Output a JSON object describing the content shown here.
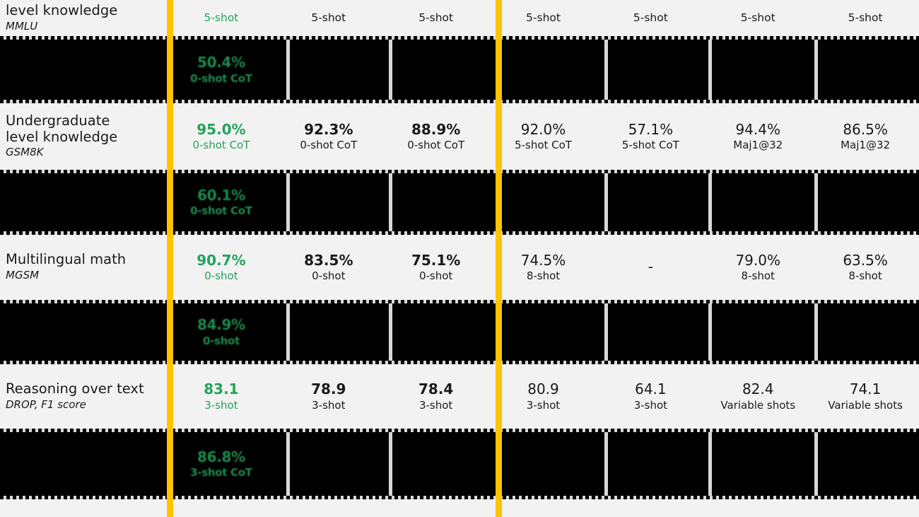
{
  "theme": {
    "accent_rail": "#ffc400",
    "highlight_green": "#23a35b",
    "page_bg": "#f2f2f2",
    "masked_bg": "#000000"
  },
  "columns": [
    {
      "id": "col-1",
      "group": "primary",
      "highlight": true
    },
    {
      "id": "col-2",
      "group": "primary",
      "highlight": false
    },
    {
      "id": "col-3",
      "group": "primary",
      "highlight": false
    },
    {
      "id": "col-4",
      "group": "secondary",
      "highlight": false
    },
    {
      "id": "col-5",
      "group": "secondary",
      "highlight": false
    },
    {
      "id": "col-6",
      "group": "secondary",
      "highlight": false
    },
    {
      "id": "col-7",
      "group": "secondary",
      "highlight": false
    }
  ],
  "rows": [
    {
      "kind": "light",
      "name": "mmlu-row",
      "label": {
        "title": "level knowledge",
        "sub": "MMLU"
      },
      "cells": [
        {
          "num": "",
          "shot": "5-shot"
        },
        {
          "num": "",
          "shot": "5-shot"
        },
        {
          "num": "",
          "shot": "5-shot"
        },
        {
          "num": "",
          "shot": "5-shot"
        },
        {
          "num": "",
          "shot": "5-shot"
        },
        {
          "num": "",
          "shot": "5-shot"
        },
        {
          "num": "",
          "shot": "5-shot"
        }
      ]
    },
    {
      "kind": "masked",
      "name": "masked-row-1",
      "label": {
        "title": "",
        "sub": ""
      },
      "cells": [
        {
          "num": "50.4%",
          "shot": "0-shot CoT"
        },
        {
          "num": "",
          "shot": ""
        },
        {
          "num": "",
          "shot": ""
        },
        {
          "num": "",
          "shot": ""
        },
        {
          "num": "",
          "shot": ""
        },
        {
          "num": "",
          "shot": ""
        },
        {
          "num": "",
          "shot": ""
        }
      ]
    },
    {
      "kind": "light",
      "name": "gsm8k-row",
      "label": {
        "title": "Undergraduate\nlevel knowledge",
        "sub": "GSM8K"
      },
      "cells": [
        {
          "num": "95.0%",
          "shot": "0-shot CoT"
        },
        {
          "num": "92.3%",
          "shot": "0-shot CoT"
        },
        {
          "num": "88.9%",
          "shot": "0-shot CoT"
        },
        {
          "num": "92.0%",
          "shot": "5-shot CoT"
        },
        {
          "num": "57.1%",
          "shot": "5-shot CoT"
        },
        {
          "num": "94.4%",
          "shot": "Maj1@32"
        },
        {
          "num": "86.5%",
          "shot": "Maj1@32"
        }
      ]
    },
    {
      "kind": "masked",
      "name": "masked-row-2",
      "label": {
        "title": "",
        "sub": ""
      },
      "cells": [
        {
          "num": "60.1%",
          "shot": "0-shot CoT"
        },
        {
          "num": "",
          "shot": ""
        },
        {
          "num": "",
          "shot": ""
        },
        {
          "num": "",
          "shot": ""
        },
        {
          "num": "",
          "shot": ""
        },
        {
          "num": "",
          "shot": ""
        },
        {
          "num": "",
          "shot": ""
        }
      ]
    },
    {
      "kind": "light",
      "name": "mgsm-row",
      "label": {
        "title": "Multilingual math",
        "sub": "MGSM"
      },
      "cells": [
        {
          "num": "90.7%",
          "shot": "0-shot"
        },
        {
          "num": "83.5%",
          "shot": "0-shot"
        },
        {
          "num": "75.1%",
          "shot": "0-shot"
        },
        {
          "num": "74.5%",
          "shot": "8-shot"
        },
        {
          "num": "-",
          "shot": ""
        },
        {
          "num": "79.0%",
          "shot": "8-shot"
        },
        {
          "num": "63.5%",
          "shot": "8-shot"
        }
      ]
    },
    {
      "kind": "masked",
      "name": "masked-row-3",
      "label": {
        "title": "",
        "sub": ""
      },
      "cells": [
        {
          "num": "84.9%",
          "shot": "0-shot"
        },
        {
          "num": "",
          "shot": ""
        },
        {
          "num": "",
          "shot": ""
        },
        {
          "num": "",
          "shot": ""
        },
        {
          "num": "",
          "shot": ""
        },
        {
          "num": "",
          "shot": ""
        },
        {
          "num": "",
          "shot": ""
        }
      ]
    },
    {
      "kind": "light",
      "name": "drop-row",
      "label": {
        "title": "Reasoning over text",
        "sub": "DROP, F1 score"
      },
      "cells": [
        {
          "num": "83.1",
          "shot": "3-shot"
        },
        {
          "num": "78.9",
          "shot": "3-shot"
        },
        {
          "num": "78.4",
          "shot": "3-shot"
        },
        {
          "num": "80.9",
          "shot": "3-shot"
        },
        {
          "num": "64.1",
          "shot": "3-shot"
        },
        {
          "num": "82.4",
          "shot": "Variable shots"
        },
        {
          "num": "74.1",
          "shot": "Variable shots"
        }
      ]
    },
    {
      "kind": "masked",
      "name": "masked-row-4",
      "label": {
        "title": "",
        "sub": ""
      },
      "cells": [
        {
          "num": "86.8%",
          "shot": "3-shot CoT"
        },
        {
          "num": "",
          "shot": ""
        },
        {
          "num": "",
          "shot": ""
        },
        {
          "num": "",
          "shot": ""
        },
        {
          "num": "",
          "shot": ""
        },
        {
          "num": "",
          "shot": ""
        },
        {
          "num": "",
          "shot": ""
        }
      ]
    }
  ]
}
